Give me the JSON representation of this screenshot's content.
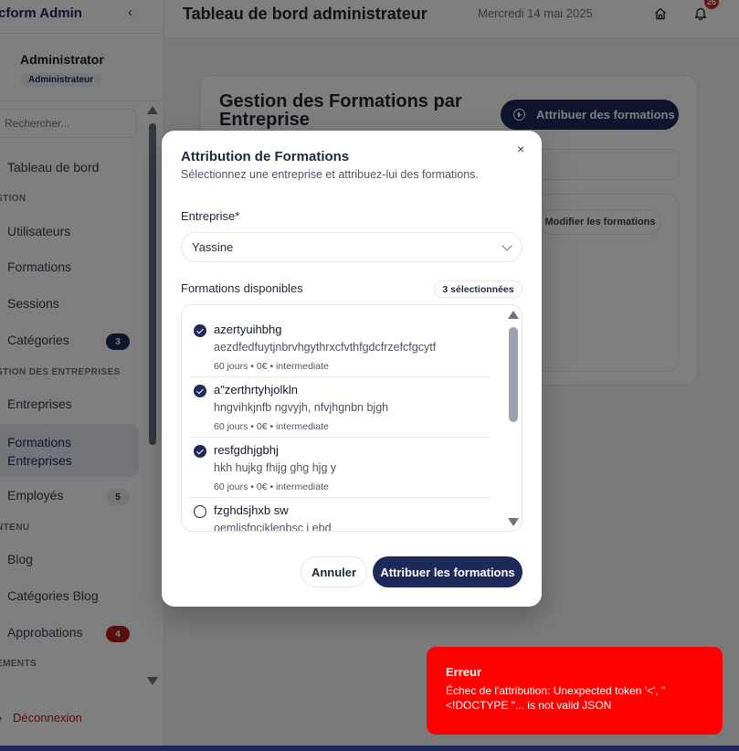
{
  "sidebar": {
    "brand": "cform Admin",
    "collapse": "‹",
    "profile": {
      "name": "Administrator",
      "role": "Administrateur"
    },
    "search_placeholder": "Rechercher...",
    "items": {
      "dashboard": "Tableau de bord",
      "gestion_section": "STION",
      "users": "Utilisateurs",
      "formations": "Formations",
      "sessions": "Sessions",
      "categories": "Catégories",
      "categories_count": "3",
      "entreprises_section": "STION DES ENTREPRISES",
      "entreprises": "Entreprises",
      "formations_entreprises": "Formations Entreprises",
      "employes": "Employés",
      "employes_count": "5",
      "contenu_section": "NTENU",
      "blog": "Blog",
      "categories_blog": "Catégories Blog",
      "approbations": "Approbations",
      "approbations_count": "4",
      "elements_section": "EMENTS"
    },
    "logout": "Déconnexion"
  },
  "header": {
    "title": "Tableau de bord administrateur",
    "date": "Mercredi 14 mai 2025",
    "notifications": "26"
  },
  "main": {
    "title": "Gestion des Formations par Entreprise",
    "assign_button": "Attribuer des formations",
    "modify_button": "Modifier les formations"
  },
  "modal": {
    "close": "×",
    "title": "Attribution de Formations",
    "subtitle": "Sélectionnez une entreprise et attribuez-lui des formations.",
    "company_label": "Entreprise*",
    "company_value": "Yassine",
    "list_label": "Formations disponibles",
    "selected_count": "3 sélectionnées",
    "formations": [
      {
        "title": "azertyuihbhg",
        "description": "aezdfedfuytjnbrvhgythrxcfvthfgdcfrzefcfgcytf",
        "meta": "60 jours  •  0€  •  intermediate",
        "checked": true
      },
      {
        "title": "a\"zerthrtyhjolkln",
        "description": "hngvihkjnfb ngvyjh, nfvjhgnbn bjgh",
        "meta": "60 jours  •  0€  •  intermediate",
        "checked": true
      },
      {
        "title": "resfgdhjgbhj",
        "description": "hkh hujkg fhijg ghg hjg y",
        "meta": "60 jours  •  0€  •  intermediate",
        "checked": true
      },
      {
        "title": "fzghdsjhxb sw",
        "description": "oemljsfncjklenbsc j ebd",
        "meta": "",
        "checked": false
      }
    ],
    "cancel_button": "Annuler",
    "submit_button": "Attribuer les formations"
  },
  "toast": {
    "title": "Erreur",
    "message": "Échec de l'attribution: Unexpected token '<', \"<!DOCTYPE \"... is not valid JSON"
  },
  "colors": {
    "primary": "#1e2a5a",
    "danger": "#ff0000",
    "badge_red": "#dc2626"
  }
}
